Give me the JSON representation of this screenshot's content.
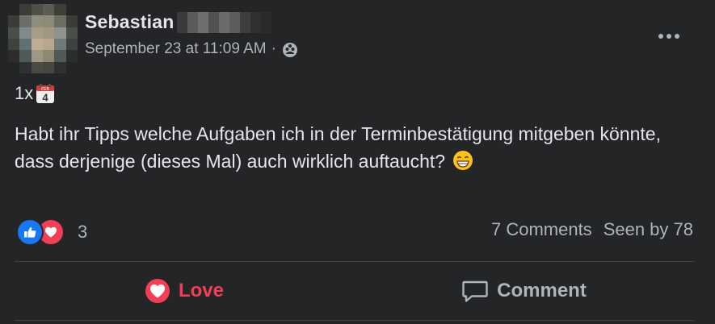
{
  "post": {
    "author": "Sebastian",
    "timestamp": "September 23 at 11:09 AM",
    "separator": "·",
    "audience_icon": "group-icon",
    "count_prefix": "1x",
    "calendar_month": "FEB",
    "calendar_day": "4",
    "text": "Habt ihr Tipps welche Aufgaben ich in der Terminbestätigung mitgeben könnte, dass derjenige (dieses Mal) auch wirklich auftaucht?",
    "emoji": "grinning-face-icon"
  },
  "engagement": {
    "reaction_icons": [
      "like-icon",
      "love-icon"
    ],
    "reaction_count": "3",
    "comments": "7 Comments",
    "seen_by": "Seen by 78"
  },
  "actions": {
    "love_label": "Love",
    "comment_label": "Comment"
  },
  "colors": {
    "background": "#242526",
    "text": "#e4e6eb",
    "secondary_text": "#b0b3b8",
    "love": "#f33e58",
    "like": "#1877f2"
  }
}
